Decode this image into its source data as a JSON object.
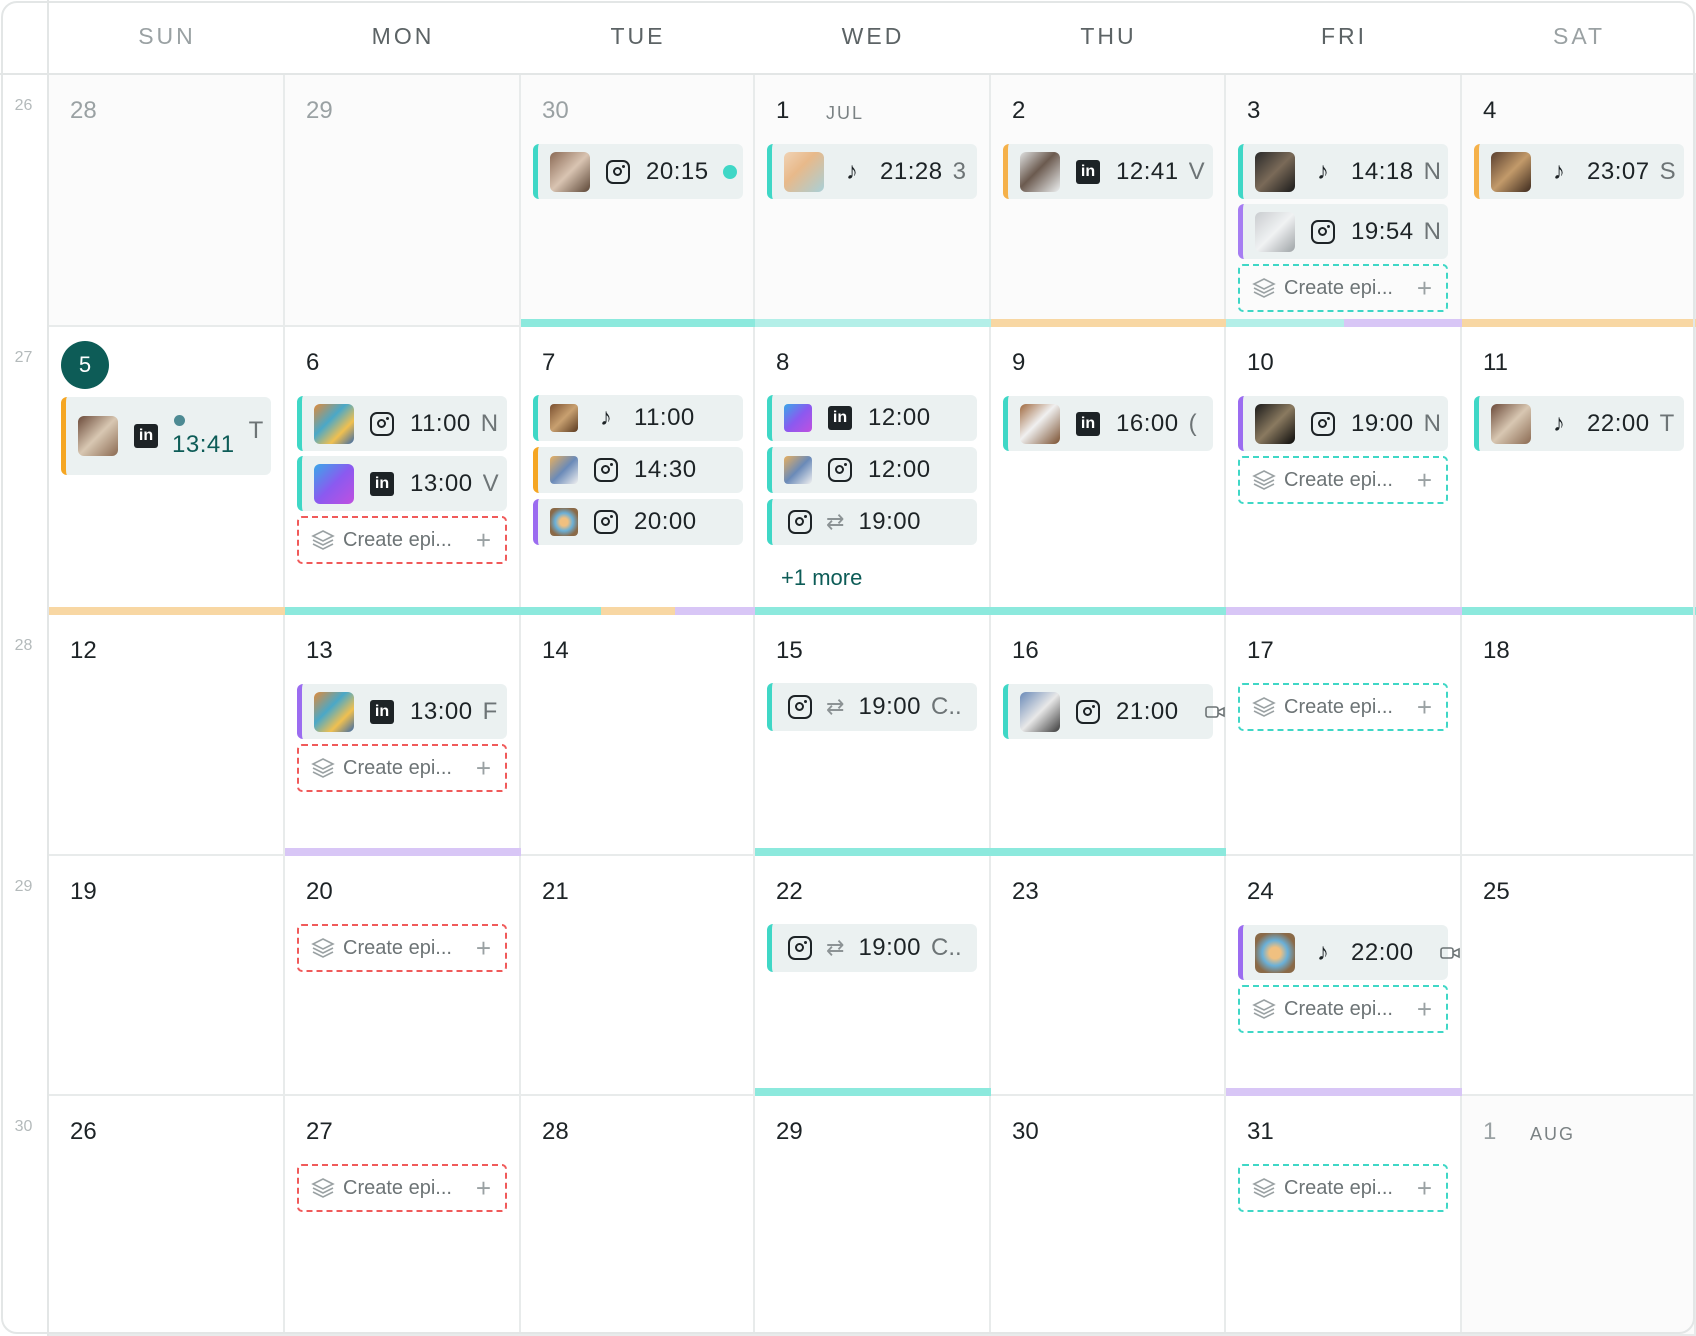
{
  "weekdays": [
    "SUN",
    "MON",
    "TUE",
    "WED",
    "THU",
    "FRI",
    "SAT"
  ],
  "week_numbers": [
    "26",
    "27",
    "28",
    "29",
    "30"
  ],
  "month_labels": {
    "jul": "JUL",
    "aug": "AUG"
  },
  "days": [
    [
      "28",
      "29",
      "30",
      "1",
      "2",
      "3",
      "4"
    ],
    [
      "5",
      "6",
      "7",
      "8",
      "9",
      "10",
      "11"
    ],
    [
      "12",
      "13",
      "14",
      "15",
      "16",
      "17",
      "18"
    ],
    [
      "19",
      "20",
      "21",
      "22",
      "23",
      "24",
      "25"
    ],
    [
      "26",
      "27",
      "28",
      "29",
      "30",
      "31",
      "1"
    ]
  ],
  "create_label": "Create epi...",
  "more_label": "+1 more",
  "events": {
    "w0_tue_1": {
      "time": "20:15",
      "network": "instagram-icon"
    },
    "w0_wed_1": {
      "time": "21:28",
      "extra": "3",
      "network": "tiktok-icon"
    },
    "w0_thu_1": {
      "time": "12:41",
      "extra": "V",
      "network": "linkedin-icon"
    },
    "w0_fri_1": {
      "time": "14:18",
      "extra": "N",
      "network": "tiktok-icon"
    },
    "w0_fri_2": {
      "time": "19:54",
      "extra": "N",
      "network": "instagram-icon"
    },
    "w0_sat_1": {
      "time": "23:07",
      "extra": "S",
      "network": "tiktok-icon"
    },
    "w1_sun_1": {
      "time": "13:41",
      "extra": "T",
      "network": "linkedin-icon"
    },
    "w1_mon_1": {
      "time": "11:00",
      "extra": "N",
      "network": "instagram-icon"
    },
    "w1_mon_2": {
      "time": "13:00",
      "extra": "V",
      "network": "linkedin-icon"
    },
    "w1_tue_1": {
      "time": "11:00",
      "network": "tiktok-icon"
    },
    "w1_tue_2": {
      "time": "14:30",
      "network": "instagram-icon"
    },
    "w1_tue_3": {
      "time": "20:00",
      "network": "instagram-icon"
    },
    "w1_wed_1": {
      "time": "12:00",
      "network": "linkedin-icon"
    },
    "w1_wed_2": {
      "time": "12:00",
      "network": "instagram-icon"
    },
    "w1_wed_3": {
      "time": "19:00",
      "network": "instagram-icon"
    },
    "w1_thu_1": {
      "time": "16:00",
      "extra": "(",
      "network": "linkedin-icon"
    },
    "w1_fri_1": {
      "time": "19:00",
      "extra": "N",
      "network": "instagram-icon"
    },
    "w1_sat_1": {
      "time": "22:00",
      "extra": "T",
      "network": "tiktok-icon"
    },
    "w2_mon_1": {
      "time": "13:00",
      "extra": "F",
      "network": "linkedin-icon"
    },
    "w2_wed_1": {
      "time": "19:00",
      "extra": "C..",
      "network": "instagram-icon"
    },
    "w2_thu_1": {
      "time": "21:00",
      "network": "instagram-icon"
    },
    "w3_wed_1": {
      "time": "19:00",
      "extra": "C..",
      "network": "instagram-icon"
    },
    "w3_fri_1": {
      "time": "22:00",
      "network": "tiktok-icon"
    }
  },
  "colors": {
    "teal": "#3fd7c6",
    "orange": "#f5a623",
    "purple": "#9b6cf0",
    "today": "#0d5c57",
    "red_dashed": "#f05a5a"
  }
}
